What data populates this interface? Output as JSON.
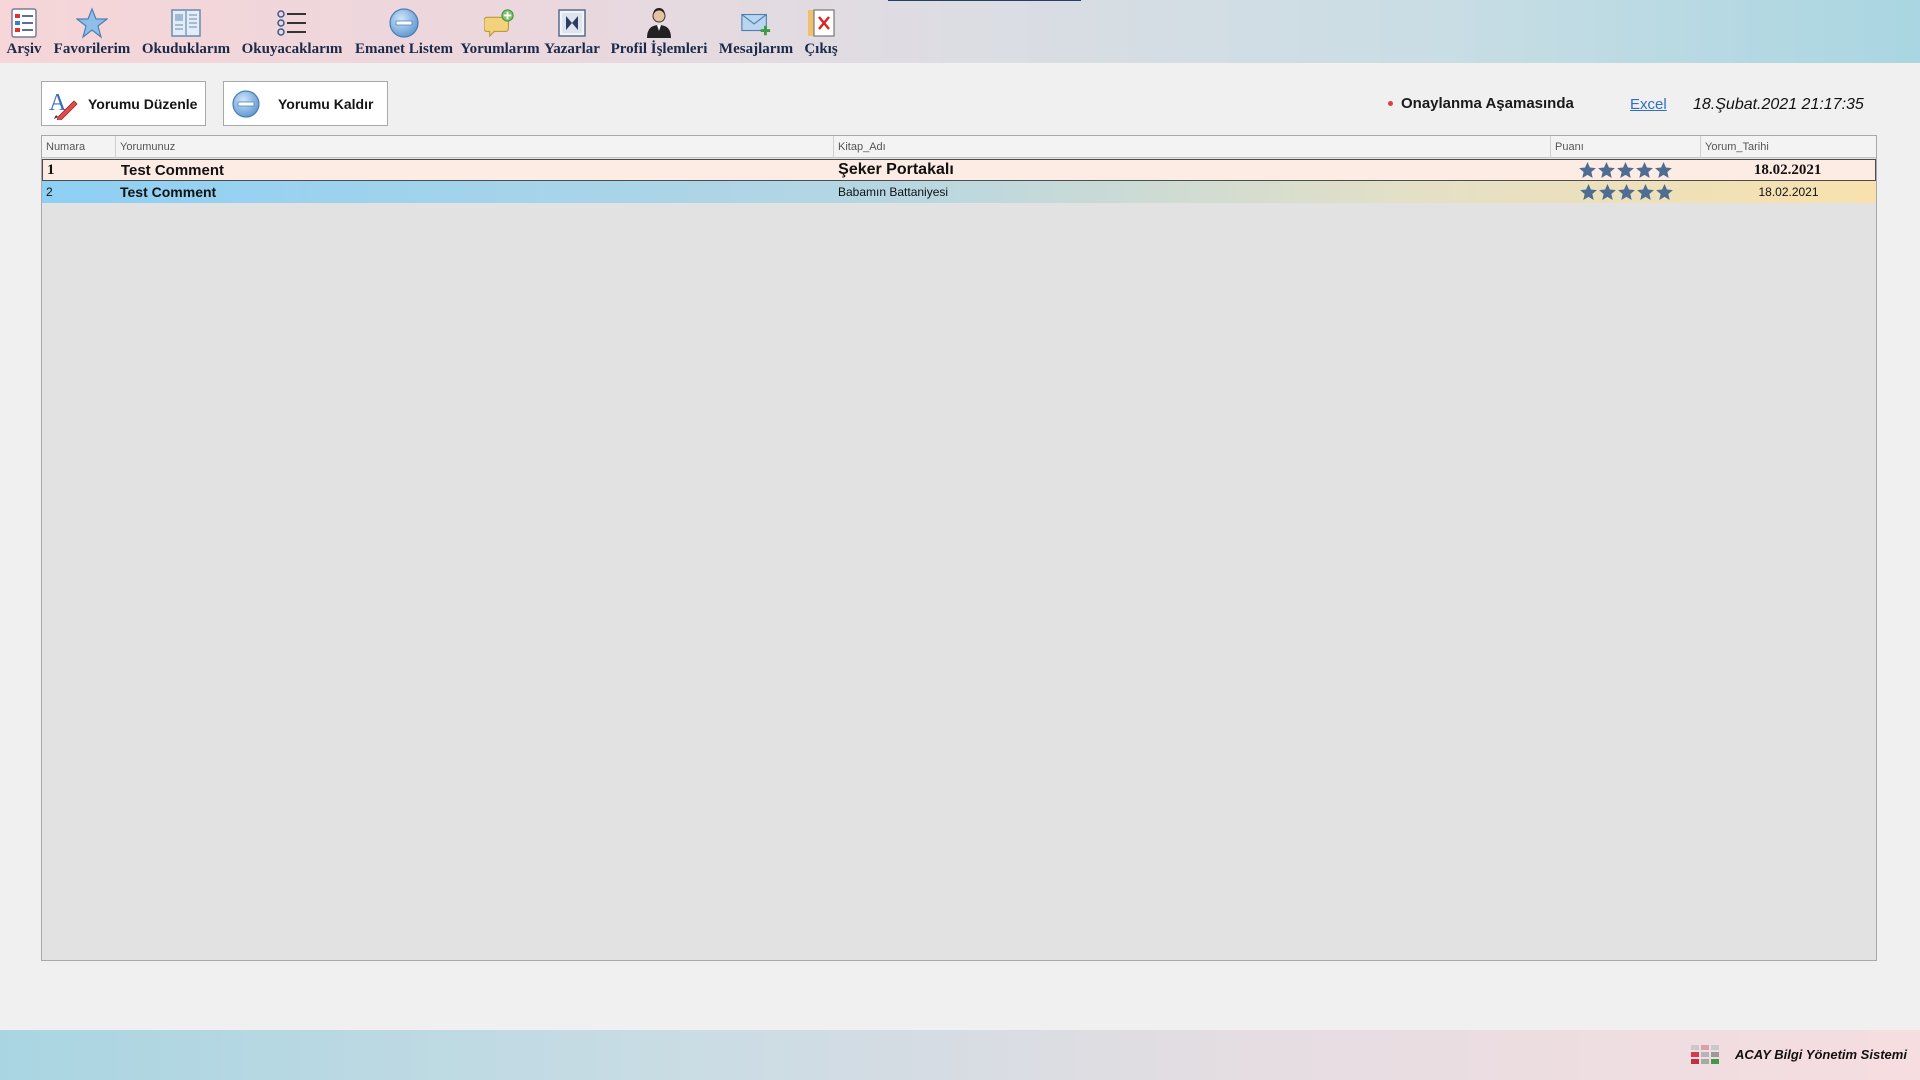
{
  "toolbar": {
    "items": [
      {
        "label": "Arşiv",
        "icon": "archive-list-icon"
      },
      {
        "label": "Favorilerim",
        "icon": "star-icon"
      },
      {
        "label": "Okuduklarım",
        "icon": "book-icon"
      },
      {
        "label": "Okuyacaklarım",
        "icon": "checklist-icon"
      },
      {
        "label": "Emanet Listem",
        "icon": "minus-circle-icon"
      },
      {
        "label": "Yorumlarım",
        "icon": "comment-add-icon"
      },
      {
        "label": "Yazarlar",
        "icon": "author-book-icon"
      },
      {
        "label": "Profil İşlemleri",
        "icon": "user-icon"
      },
      {
        "label": "Mesajlarım",
        "icon": "mail-add-icon"
      },
      {
        "label": "Çıkış",
        "icon": "exit-icon"
      }
    ]
  },
  "actions": {
    "edit_label": "Yorumu Düzenle",
    "remove_label": "Yorumu Kaldır"
  },
  "status": {
    "text": "Onaylanma Aşamasında",
    "dot_color": "#e03d3d"
  },
  "excel_label": "Excel",
  "clock": "18.Şubat.2021 21:17:35",
  "grid": {
    "columns": [
      "Numara",
      "Yorumunuz",
      "Kitap_Adı",
      "Puanı",
      "Yorum_Tarihi"
    ],
    "rows": [
      {
        "num": "1",
        "comment": "Test Comment",
        "book": "Şeker Portakalı",
        "rating": 5,
        "date": "18.02.2021"
      },
      {
        "num": "2",
        "comment": "Test Comment",
        "book": "Babamın Battaniyesi",
        "rating": 5,
        "date": "18.02.2021"
      }
    ]
  },
  "footer": {
    "text": "ACAY Bilgi Yönetim Sistemi"
  },
  "colors": {
    "star": "#4f6d92",
    "link": "#2c6fc4"
  }
}
